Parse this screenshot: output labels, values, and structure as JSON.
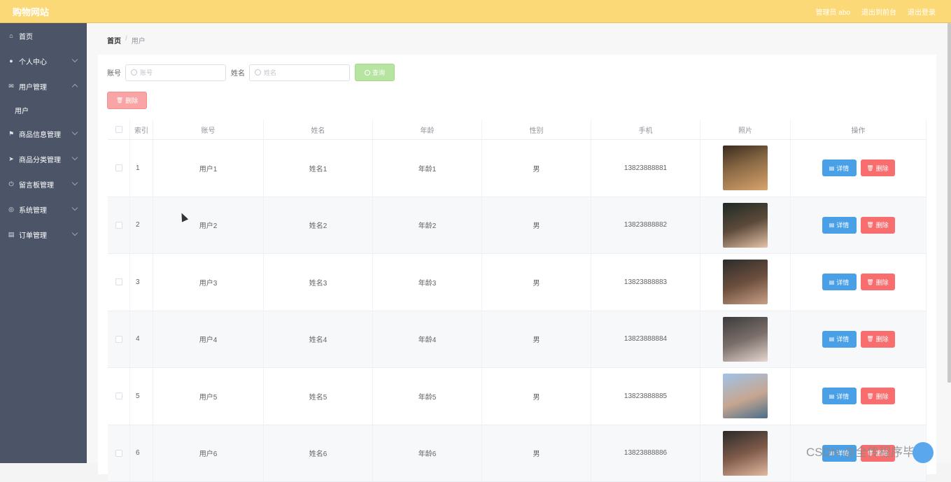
{
  "header": {
    "site_title": "购物网站",
    "links": [
      "管理员 abo",
      "退出到前台",
      "退出登录"
    ]
  },
  "sidebar": {
    "items": [
      {
        "label": "首页",
        "icon": "home-icon",
        "expandable": false
      },
      {
        "label": "个人中心",
        "icon": "user-icon",
        "expandable": true
      },
      {
        "label": "用户管理",
        "icon": "mail-icon",
        "expandable": true,
        "expanded": true,
        "children": [
          "用户"
        ]
      },
      {
        "label": "商品信息管理",
        "icon": "flag-icon",
        "expandable": true
      },
      {
        "label": "商品分类管理",
        "icon": "send-icon",
        "expandable": true
      },
      {
        "label": "留言板管理",
        "icon": "power-icon",
        "expandable": true
      },
      {
        "label": "系统管理",
        "icon": "compass-icon",
        "expandable": true
      },
      {
        "label": "订单管理",
        "icon": "clipboard-icon",
        "expandable": true
      }
    ]
  },
  "breadcrumb": {
    "home": "首页",
    "sep": "/",
    "current": "用户"
  },
  "search": {
    "account_label": "账号",
    "account_placeholder": "账号",
    "name_label": "姓名",
    "name_placeholder": "姓名",
    "query_button": "查询"
  },
  "bulk_delete_label": "删除",
  "table": {
    "headers": [
      "",
      "索引",
      "账号",
      "姓名",
      "年龄",
      "性别",
      "手机",
      "照片",
      "操作"
    ],
    "rows": [
      {
        "index": "1",
        "account": "用户1",
        "name": "姓名1",
        "age": "年龄1",
        "gender": "男",
        "phone": "13823888881"
      },
      {
        "index": "2",
        "account": "用户2",
        "name": "姓名2",
        "age": "年龄2",
        "gender": "男",
        "phone": "13823888882"
      },
      {
        "index": "3",
        "account": "用户3",
        "name": "姓名3",
        "age": "年龄3",
        "gender": "男",
        "phone": "13823888883"
      },
      {
        "index": "4",
        "account": "用户4",
        "name": "姓名4",
        "age": "年龄4",
        "gender": "男",
        "phone": "13823888884"
      },
      {
        "index": "5",
        "account": "用户5",
        "name": "姓名5",
        "age": "年龄5",
        "gender": "男",
        "phone": "13823888885"
      },
      {
        "index": "6",
        "account": "用户6",
        "name": "姓名6",
        "age": "年龄6",
        "gender": "男",
        "phone": "13823888886"
      }
    ],
    "detail_label": "详情",
    "delete_label": "删除"
  },
  "watermark": "CSDN @全传程序毕设",
  "colors": {
    "topbar": "#fcd977",
    "sidebar": "#4b5567",
    "detail_button": "#4aa0e6",
    "delete_button": "#f86e6e",
    "query_button": "#b7e4a0"
  }
}
